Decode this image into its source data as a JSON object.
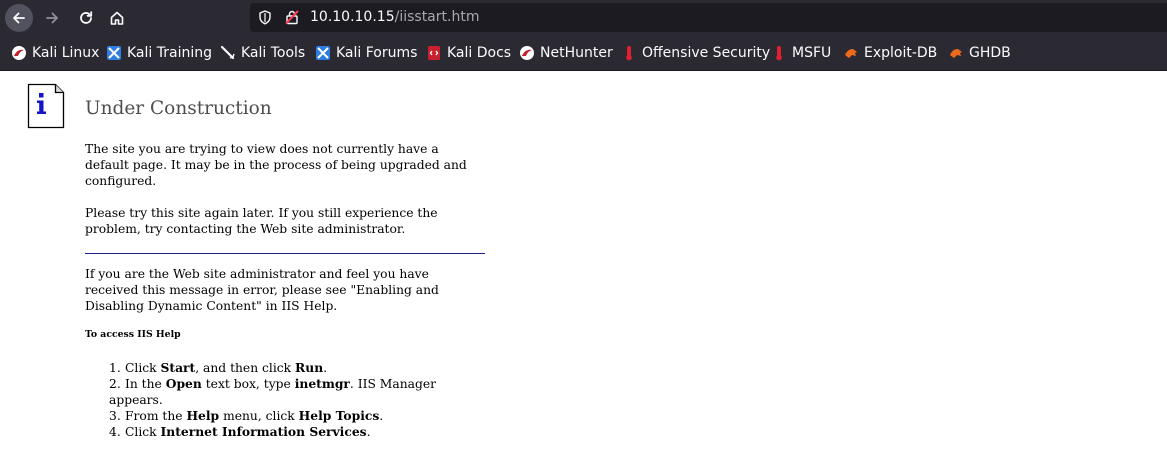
{
  "browser": {
    "url_host": "10.10.10.15",
    "url_path": "/iisstart.htm"
  },
  "bookmarks": [
    {
      "label": "Kali Linux",
      "icon": "kali-linux-icon"
    },
    {
      "label": "Kali Training",
      "icon": "kali-training-icon"
    },
    {
      "label": "Kali Tools",
      "icon": "kali-tools-icon"
    },
    {
      "label": "Kali Forums",
      "icon": "kali-forums-icon"
    },
    {
      "label": "Kali Docs",
      "icon": "kali-docs-icon"
    },
    {
      "label": "NetHunter",
      "icon": "nethunter-icon"
    },
    {
      "label": "Offensive Security",
      "icon": "offensive-security-icon"
    },
    {
      "label": "MSFU",
      "icon": "msfu-icon"
    },
    {
      "label": "Exploit-DB",
      "icon": "exploit-db-icon"
    },
    {
      "label": "GHDB",
      "icon": "ghdb-icon"
    }
  ],
  "page": {
    "title": "Under Construction",
    "para1": "The site you are trying to view does not currently have a default page. It may be in the process of being upgraded and configured.",
    "para2": "Please try this site again later. If you still experience the problem, try contacting the Web site administrator.",
    "para3": "If you are the Web site administrator and feel you have received this message in error, please see \"Enabling and Disabling Dynamic Content\" in IIS Help.",
    "help_heading": "To access IIS Help",
    "steps": [
      {
        "num": "1.",
        "pre": "Click ",
        "b1": "Start",
        "mid": ", and then click ",
        "b2": "Run",
        "post": "."
      },
      {
        "num": "2.",
        "pre": "In the ",
        "b1": "Open",
        "mid": " text box, type ",
        "b2": "inetmgr",
        "post": ". IIS Manager appears."
      },
      {
        "num": "3.",
        "pre": "From the ",
        "b1": "Help",
        "mid": " menu, click ",
        "b2": "Help Topics",
        "post": "."
      },
      {
        "num": "4.",
        "pre": "Click ",
        "b1": "Internet Information Services",
        "mid": "",
        "b2": "",
        "post": "."
      }
    ]
  },
  "colors": {
    "toolbar_bg": "#2b2a33",
    "urlbar_bg": "#1c1b22",
    "divider": "#1e1e8c",
    "title": "#4e4e4e"
  }
}
